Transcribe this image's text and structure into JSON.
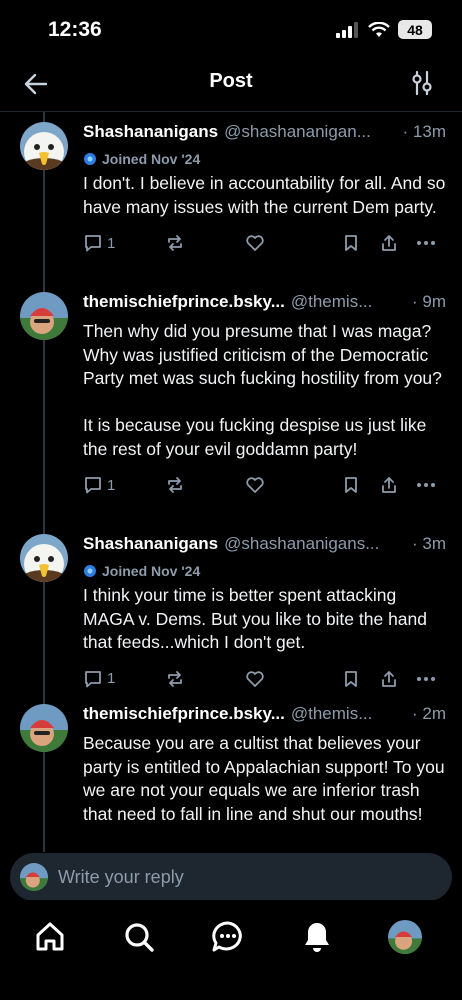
{
  "status_bar": {
    "time": "12:36",
    "battery": "48"
  },
  "header": {
    "title": "Post"
  },
  "posts": [
    {
      "name": "Shashananigans",
      "handle": "@shashananigan...",
      "time": "· 13m",
      "joined": "Joined Nov '24",
      "text": "I don't. I believe in accountability for all. And so have many issues with the current Dem party.",
      "reply_count": "1",
      "avatar_icon": "eagle-icon"
    },
    {
      "name": "themischiefprince.bsky...",
      "handle": "@themis...",
      "time": "· 9m",
      "text": "Then why did you presume that I was maga? Why was justified criticism of the Democratic Party met was such fucking hostility from you?\n\nIt is because you fucking despise us just like the rest of your evil goddamn party!",
      "reply_count": "1",
      "avatar_icon": "selfie-icon"
    },
    {
      "name": "Shashananigans",
      "handle": "@shashananigans...",
      "time": "· 3m",
      "joined": "Joined Nov '24",
      "text": "I think your time is better spent attacking MAGA v. Dems. But you like to bite the hand that feeds...which I don't get.",
      "reply_count": "1",
      "avatar_icon": "eagle-icon"
    },
    {
      "name": "themischiefprince.bsky...",
      "handle": "@themis...",
      "time": "· 2m",
      "text": "Because you are a cultist that believes your party is entitled to Appalachian support! To you we are not your equals we are inferior trash that need to fall in line and shut our mouths!",
      "avatar_icon": "selfie-icon"
    }
  ],
  "reply_bar": {
    "placeholder": "Write your reply"
  },
  "nav": [
    "home-icon",
    "search-icon",
    "chat-icon",
    "bell-icon",
    "profile-avatar"
  ],
  "colors": {
    "background": "#000000",
    "muted": "#8d9bab",
    "thread_line": "#2c3642",
    "input_bg": "#1e2630"
  }
}
